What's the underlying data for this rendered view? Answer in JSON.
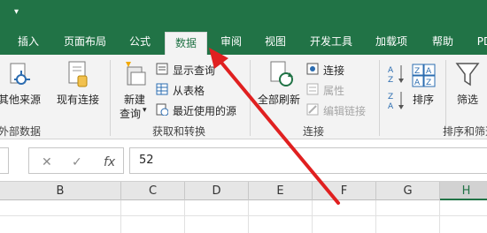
{
  "tabs": [
    "插入",
    "页面布局",
    "公式",
    "数据",
    "审阅",
    "视图",
    "开发工具",
    "加载项",
    "帮助",
    "PD"
  ],
  "active_tab": "数据",
  "ribbon": {
    "get_external": {
      "label": "其他来源",
      "group": "外部数据"
    },
    "existing_conn": {
      "label": "现有连接"
    },
    "new_query": {
      "label_line1": "新建",
      "label_line2": "查询"
    },
    "show_queries": "显示查询",
    "from_table": "从表格",
    "recent_sources": "最近使用的源",
    "group_get_transform": "获取和转换",
    "refresh_all": "全部刷新",
    "connections": "连接",
    "properties": "属性",
    "edit_links": "编辑链接",
    "group_connections": "连接",
    "sort": "排序",
    "filter": "筛选",
    "group_sort_filter": "排序和筛选"
  },
  "formula_bar": {
    "value": "52",
    "fx": "fx"
  },
  "columns": [
    "B",
    "C",
    "D",
    "E",
    "F",
    "G",
    "H"
  ],
  "active_column": "H",
  "colors": {
    "brand_green": "#217346",
    "arrow_red": "#e02020"
  }
}
